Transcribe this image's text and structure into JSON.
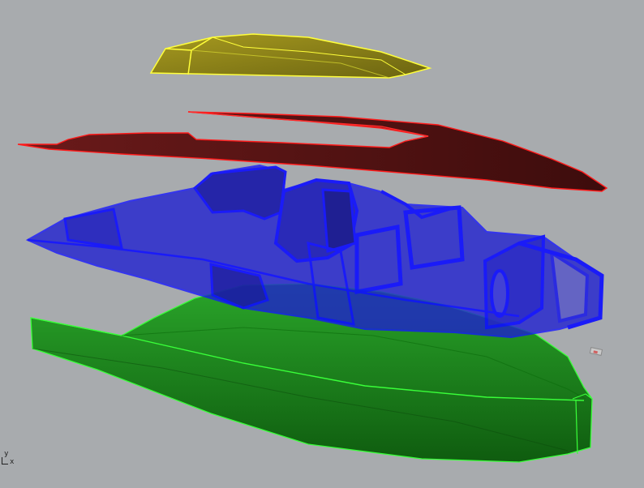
{
  "viewport": {
    "axis_labels": {
      "y": "y",
      "x": "x"
    },
    "background_color": "#a8abae"
  },
  "parts": [
    {
      "name": "canopy",
      "fill": "#9a8e1e",
      "edge": "#ffff3a"
    },
    {
      "name": "deck",
      "fill": "#5a1414",
      "edge": "#ff1a1a"
    },
    {
      "name": "interior-structure",
      "fill": "#1f1fd0",
      "edge": "#1414ff"
    },
    {
      "name": "hull",
      "fill": "#1e8c1e",
      "edge": "#39ff39"
    }
  ]
}
